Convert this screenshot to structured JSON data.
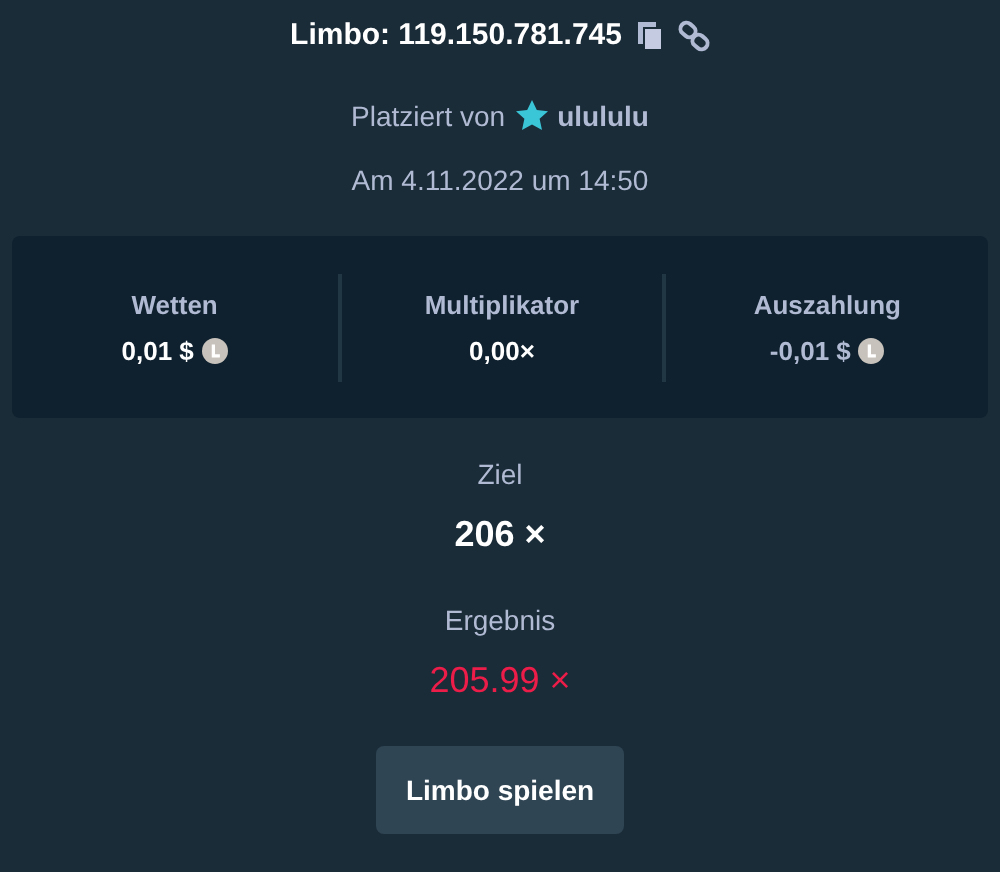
{
  "title": "Limbo: 119.150.781.745",
  "placed_by": {
    "label": "Platziert von",
    "user": "ulululu"
  },
  "date": "Am 4.11.2022 um 14:50",
  "stats": [
    {
      "label": "Wetten",
      "value": "0,01 $",
      "coin": true,
      "negative": false
    },
    {
      "label": "Multiplikator",
      "value": "0,00×",
      "coin": false,
      "negative": false
    },
    {
      "label": "Auszahlung",
      "value": "-0,01 $",
      "coin": true,
      "negative": true
    }
  ],
  "target": {
    "label": "Ziel",
    "value": "206 ×"
  },
  "result": {
    "label": "Ergebnis",
    "value": "205.99 ×",
    "win": false
  },
  "button": "Limbo spielen"
}
